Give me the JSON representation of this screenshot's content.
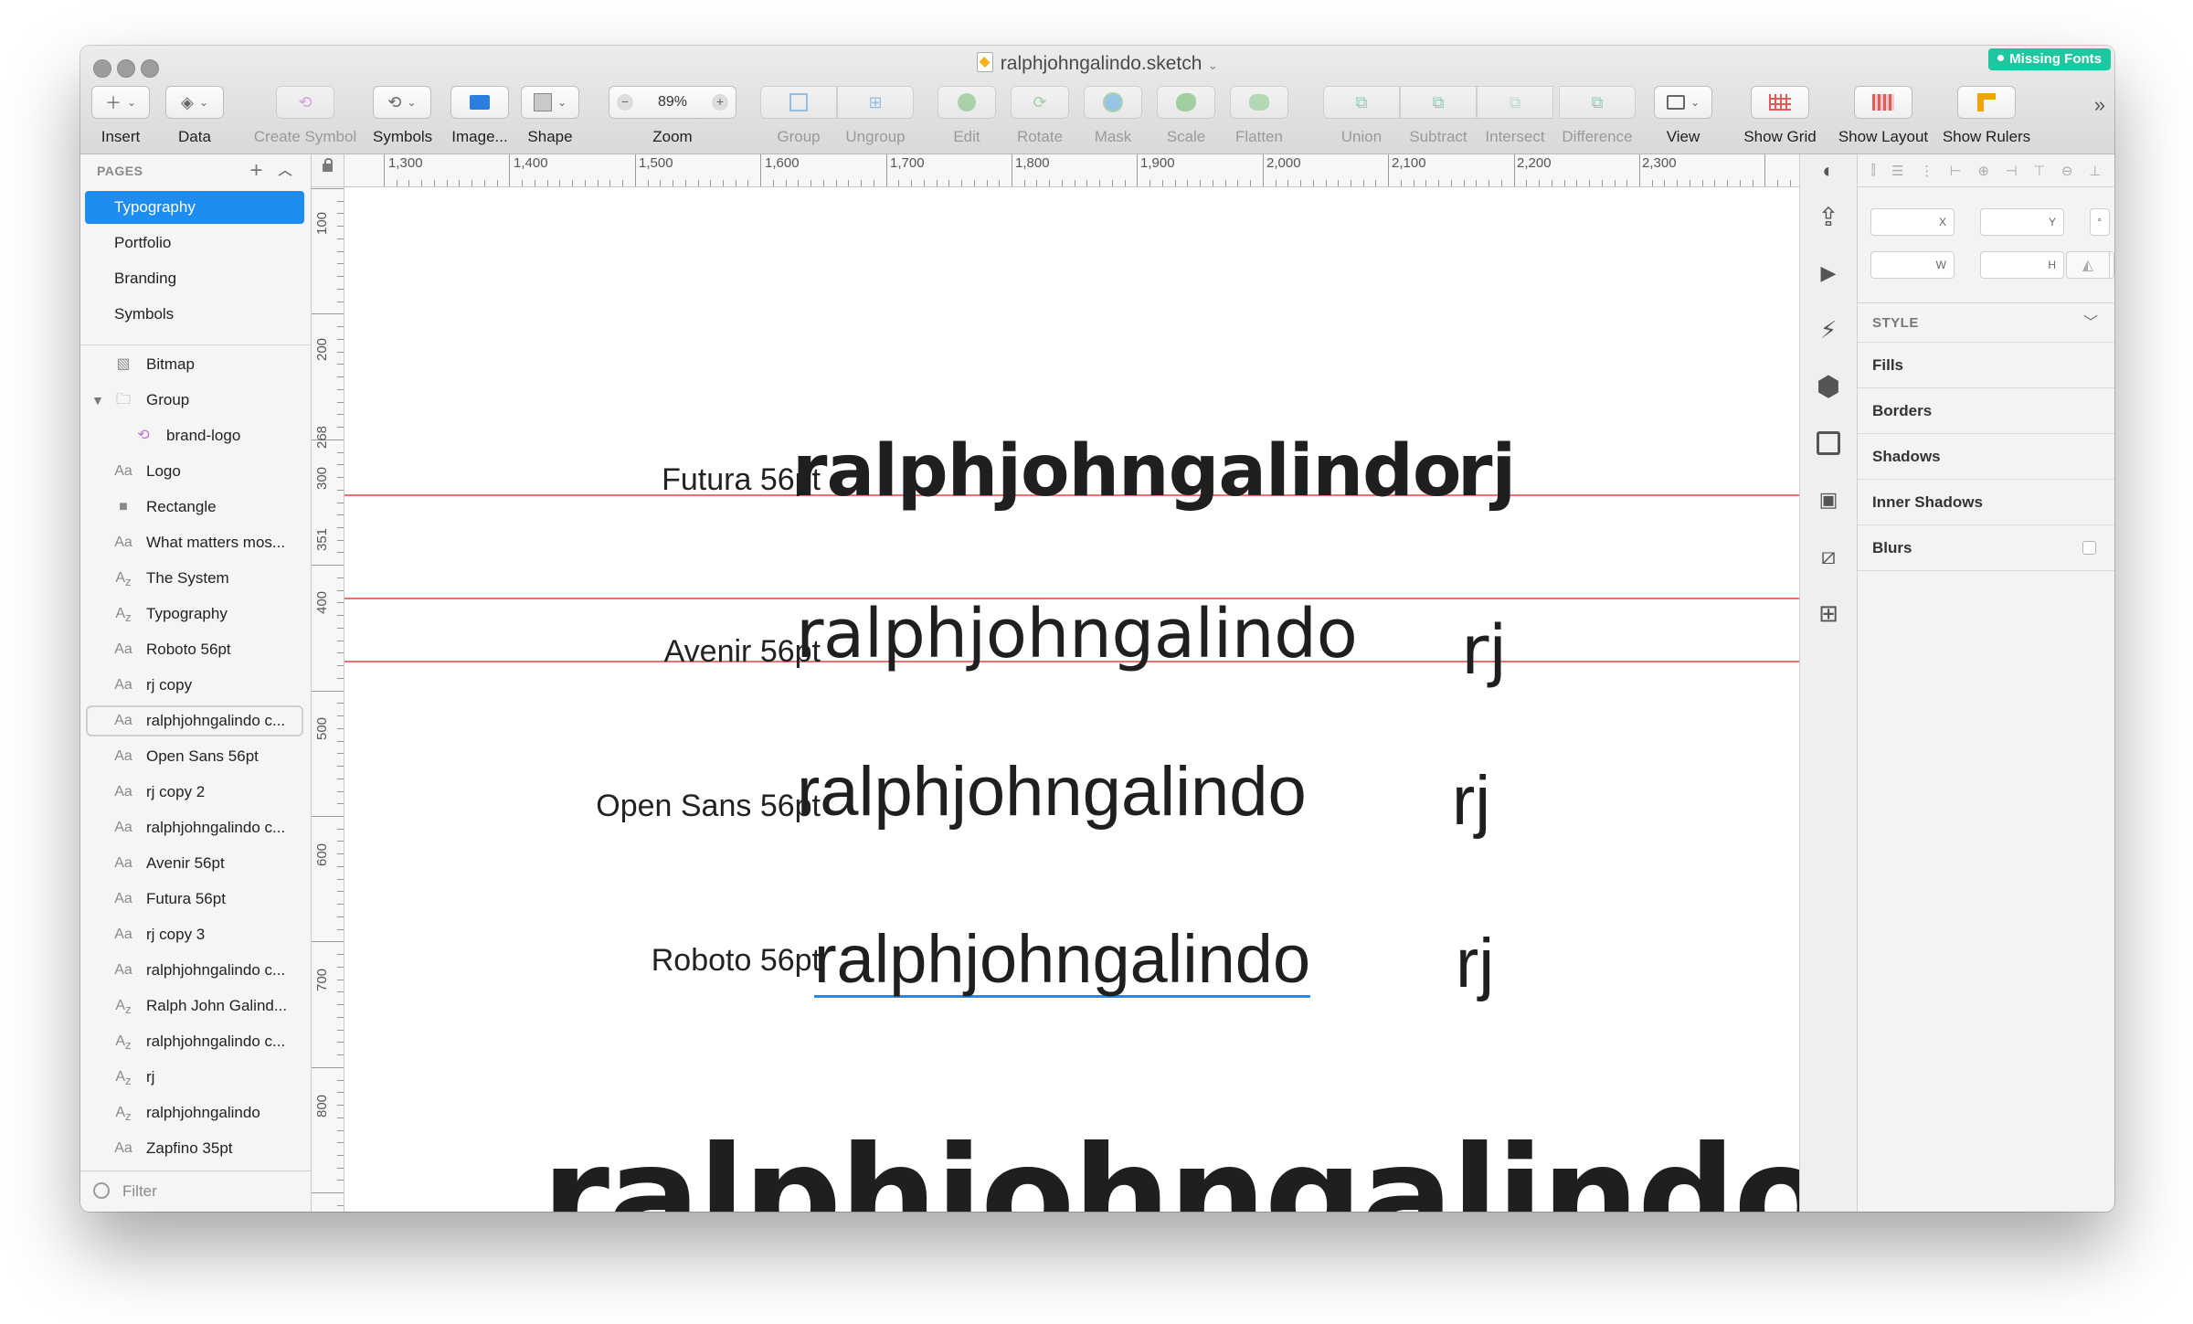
{
  "window": {
    "title": "ralphjohngalindo.sketch",
    "badge": "Missing Fonts"
  },
  "toolbar": {
    "insert": "Insert",
    "data": "Data",
    "create_symbol": "Create Symbol",
    "symbols": "Symbols",
    "image": "Image...",
    "shape": "Shape",
    "zoom": "Zoom",
    "zoom_value": "89%",
    "group": "Group",
    "ungroup": "Ungroup",
    "edit": "Edit",
    "rotate": "Rotate",
    "mask": "Mask",
    "scale": "Scale",
    "flatten": "Flatten",
    "union": "Union",
    "subtract": "Subtract",
    "intersect": "Intersect",
    "difference": "Difference",
    "view": "View",
    "show_grid": "Show Grid",
    "show_layout": "Show Layout",
    "show_rulers": "Show Rulers"
  },
  "sidebar": {
    "pages_header": "PAGES",
    "pages": [
      "Typography",
      "Portfolio",
      "Branding",
      "Symbols"
    ],
    "layers": [
      {
        "icon": "bitmap",
        "name": "Bitmap"
      },
      {
        "icon": "folder",
        "name": "Group"
      },
      {
        "icon": "symbol",
        "name": "brand-logo"
      },
      {
        "icon": "text",
        "name": "Logo"
      },
      {
        "icon": "rectangle",
        "name": "Rectangle"
      },
      {
        "icon": "text",
        "name": "What matters mos..."
      },
      {
        "icon": "text-path",
        "name": "The System"
      },
      {
        "icon": "text-path",
        "name": "Typography"
      },
      {
        "icon": "text",
        "name": "Roboto 56pt"
      },
      {
        "icon": "text",
        "name": "rj copy"
      },
      {
        "icon": "text",
        "name": "ralphjohngalindo c..."
      },
      {
        "icon": "text",
        "name": "Open Sans 56pt"
      },
      {
        "icon": "text",
        "name": "rj copy 2"
      },
      {
        "icon": "text",
        "name": "ralphjohngalindo c..."
      },
      {
        "icon": "text",
        "name": "Avenir 56pt"
      },
      {
        "icon": "text",
        "name": "Futura 56pt"
      },
      {
        "icon": "text",
        "name": "rj copy 3"
      },
      {
        "icon": "text",
        "name": "ralphjohngalindo c..."
      },
      {
        "icon": "text-path",
        "name": "Ralph John Galind..."
      },
      {
        "icon": "text-path",
        "name": "ralphjohngalindo c..."
      },
      {
        "icon": "text-path",
        "name": "rj"
      },
      {
        "icon": "text-path",
        "name": "ralphjohngalindo"
      },
      {
        "icon": "text",
        "name": "Zapfino 35pt"
      }
    ],
    "filter_placeholder": "Filter"
  },
  "rulers": {
    "horizontal": [
      "1,300",
      "1,400",
      "1,500",
      "1,600",
      "1,700",
      "1,800",
      "1,900",
      "2,000",
      "2,100",
      "2,200",
      "2,300"
    ],
    "vertical": [
      "100",
      "200",
      "268",
      "300",
      "351",
      "400",
      "500",
      "600",
      "700",
      "800"
    ]
  },
  "canvas": {
    "rows": [
      {
        "label": "Futura 56pt",
        "sample": "ralphjohngalindo",
        "short": "rj"
      },
      {
        "label": "Avenir 56pt",
        "sample": "ralphjohngalindo",
        "short": "rj"
      },
      {
        "label": "Open Sans 56pt",
        "sample": "ralphjohngalindo",
        "short": "rj"
      },
      {
        "label": "Roboto 56pt",
        "sample": "ralphjohngalindo",
        "short": "rj"
      }
    ],
    "bottom_sample": "ralphjohngalindo",
    "guide_color": "#f07070"
  },
  "inspector": {
    "x_label": "X",
    "y_label": "Y",
    "rotation_label": "°",
    "w_label": "W",
    "h_label": "H",
    "style_header": "STYLE",
    "sections": [
      "Fills",
      "Borders",
      "Shadows",
      "Inner Shadows",
      "Blurs"
    ]
  },
  "colors": {
    "accent": "#1e8cf0",
    "badge": "#1fc7a1",
    "guide": "#f07070"
  }
}
